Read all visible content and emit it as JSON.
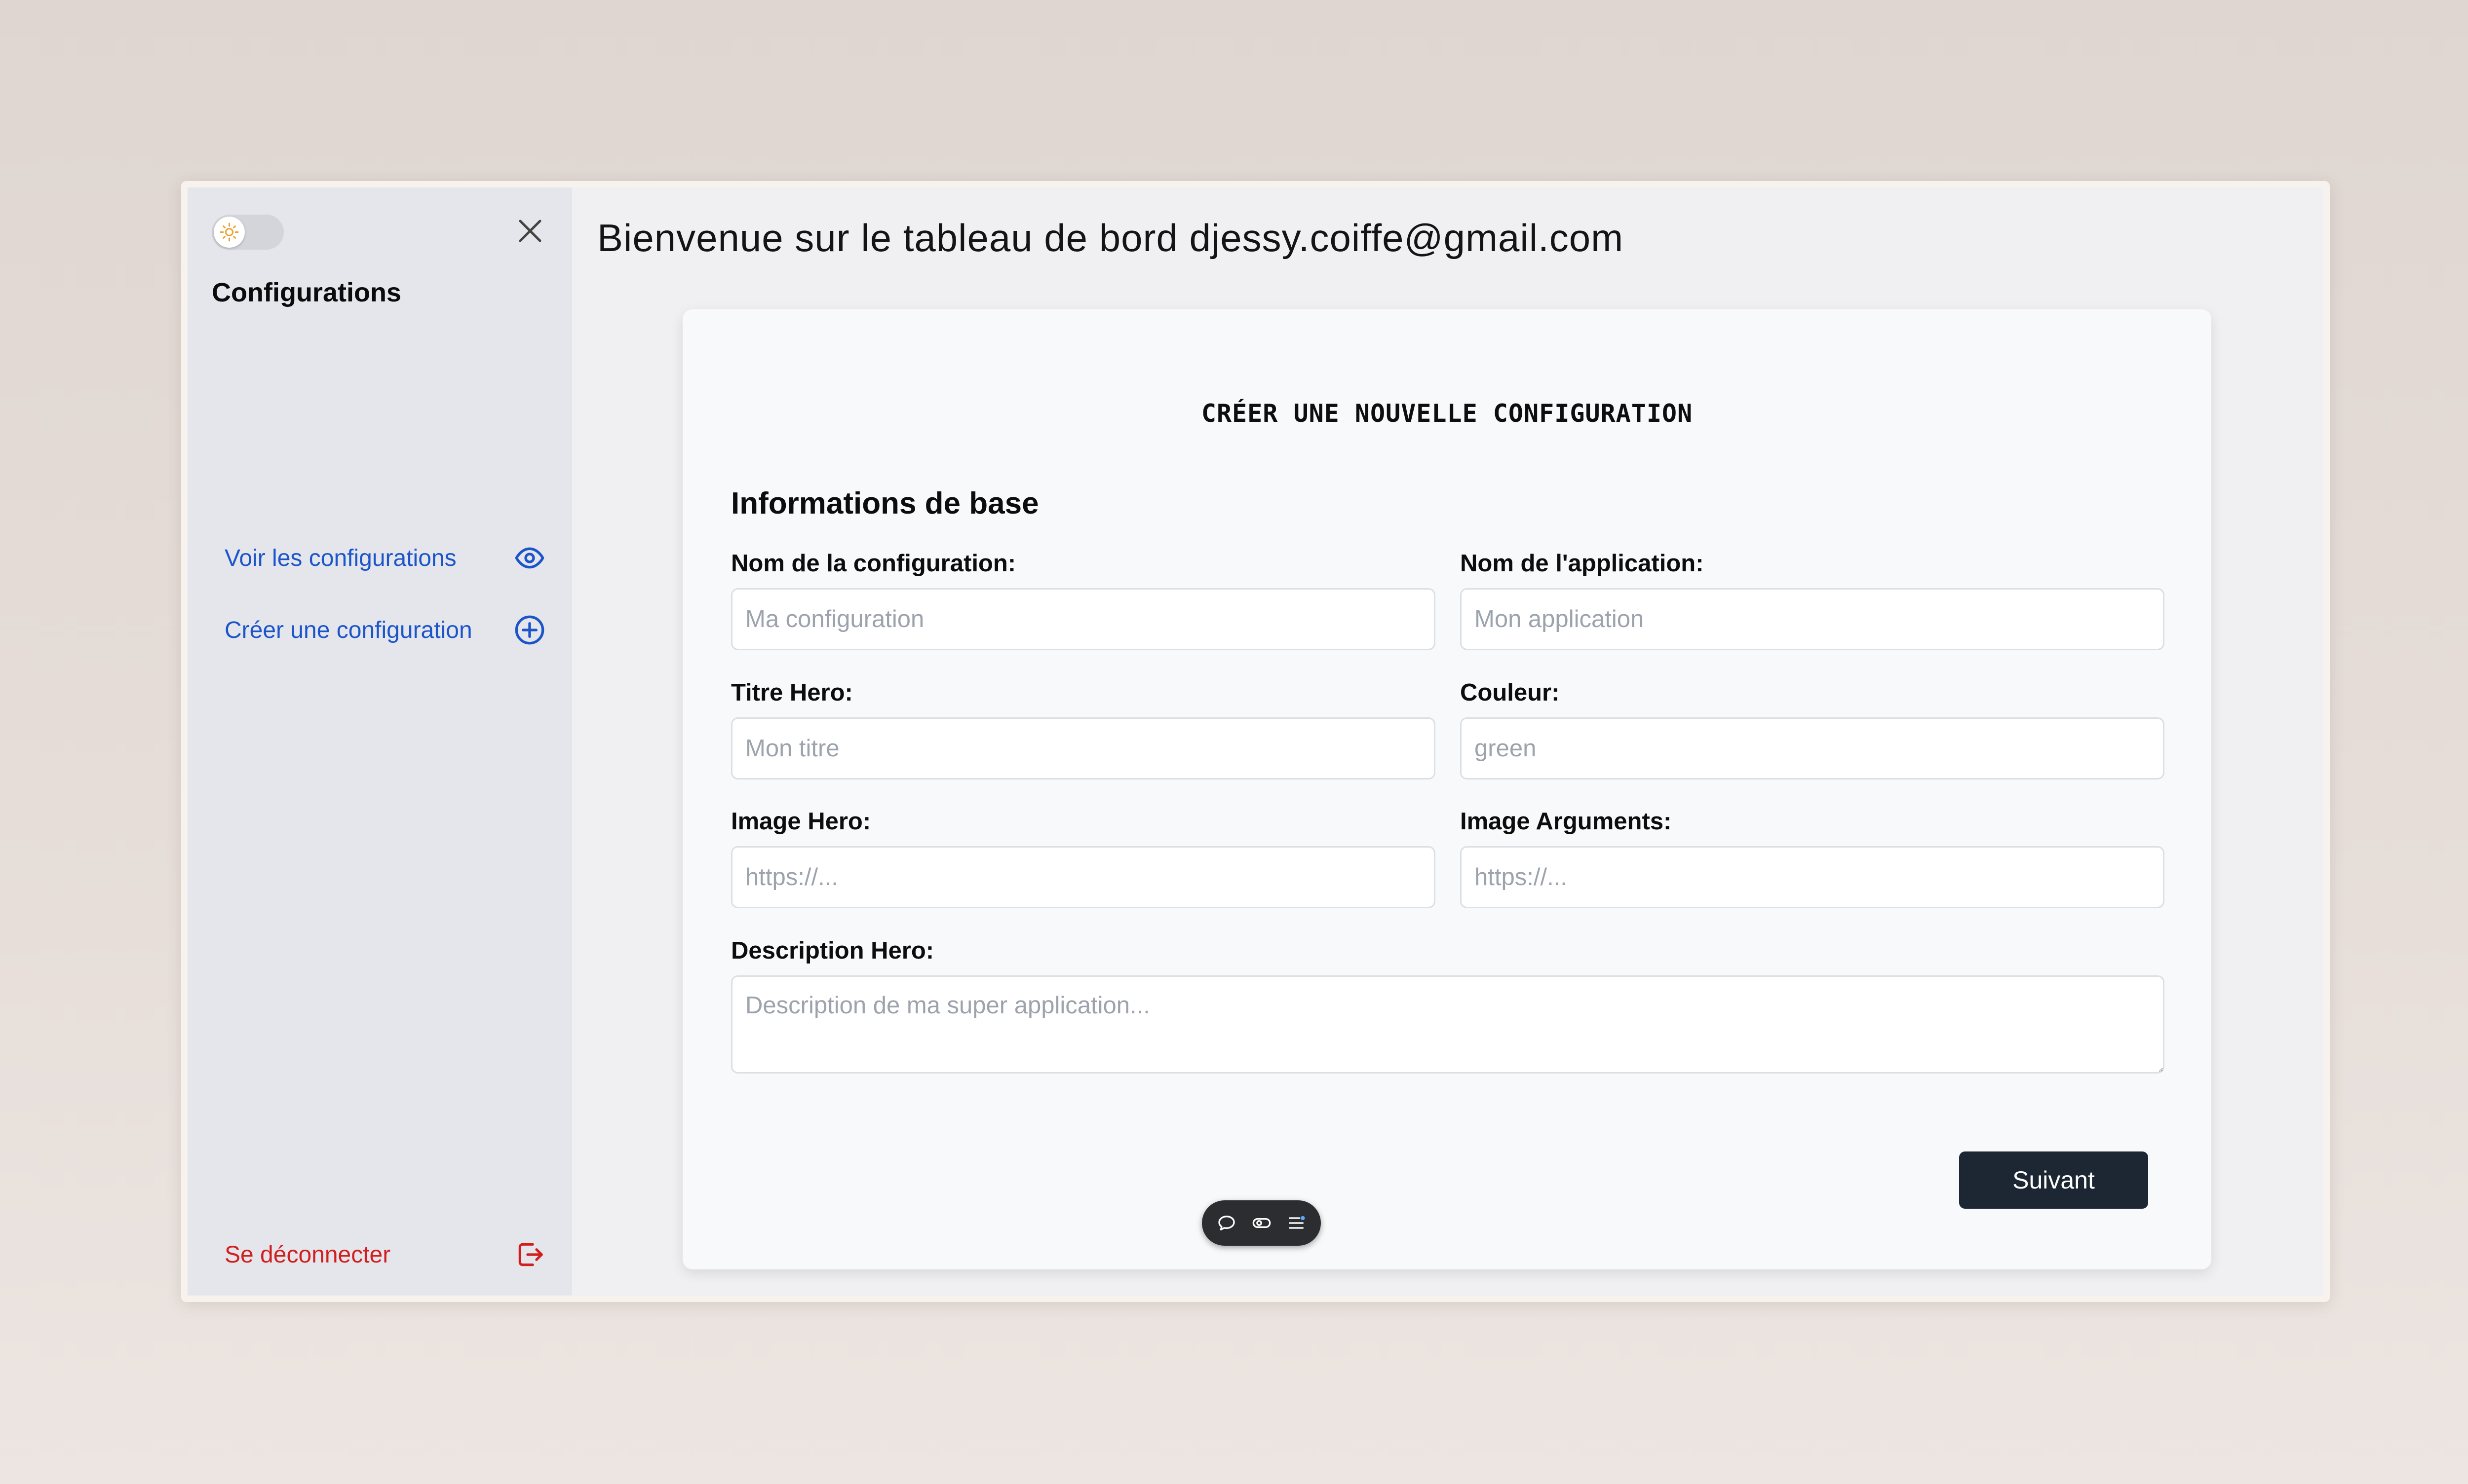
{
  "sidebar": {
    "title": "Configurations",
    "items": [
      {
        "label": "Voir les configurations",
        "icon": "eye-icon"
      },
      {
        "label": "Créer une configuration",
        "icon": "plus-circle-icon"
      }
    ],
    "logout_label": "Se déconnecter",
    "logout_icon": "logout-icon",
    "theme_toggle_icon": "sun-icon",
    "close_icon": "close-icon"
  },
  "header": {
    "welcome": "Bienvenue sur le tableau de bord djessy.coiffe@gmail.com"
  },
  "form": {
    "title": "CRÉER UNE NOUVELLE CONFIGURATION",
    "section_title": "Informations de base",
    "fields": {
      "config_name": {
        "label": "Nom de la configuration:",
        "placeholder": "Ma configuration",
        "value": ""
      },
      "app_name": {
        "label": "Nom de l'application:",
        "placeholder": "Mon application",
        "value": ""
      },
      "hero_title": {
        "label": "Titre Hero:",
        "placeholder": "Mon titre",
        "value": ""
      },
      "color": {
        "label": "Couleur:",
        "placeholder": "green",
        "value": ""
      },
      "hero_image": {
        "label": "Image Hero:",
        "placeholder": "https://...",
        "value": ""
      },
      "args_image": {
        "label": "Image Arguments:",
        "placeholder": "https://...",
        "value": ""
      },
      "hero_description": {
        "label": "Description Hero:",
        "placeholder": "Description de ma super application...",
        "value": ""
      }
    },
    "next_label": "Suivant"
  },
  "floating_toolbar": {
    "icons": [
      "comment-icon",
      "toggle-icon",
      "list-icon"
    ]
  },
  "colors": {
    "link_blue": "#1c55c9",
    "logout_red": "#d11f1f",
    "button_dark": "#1d2633",
    "toggle_sun": "#f0a030"
  }
}
